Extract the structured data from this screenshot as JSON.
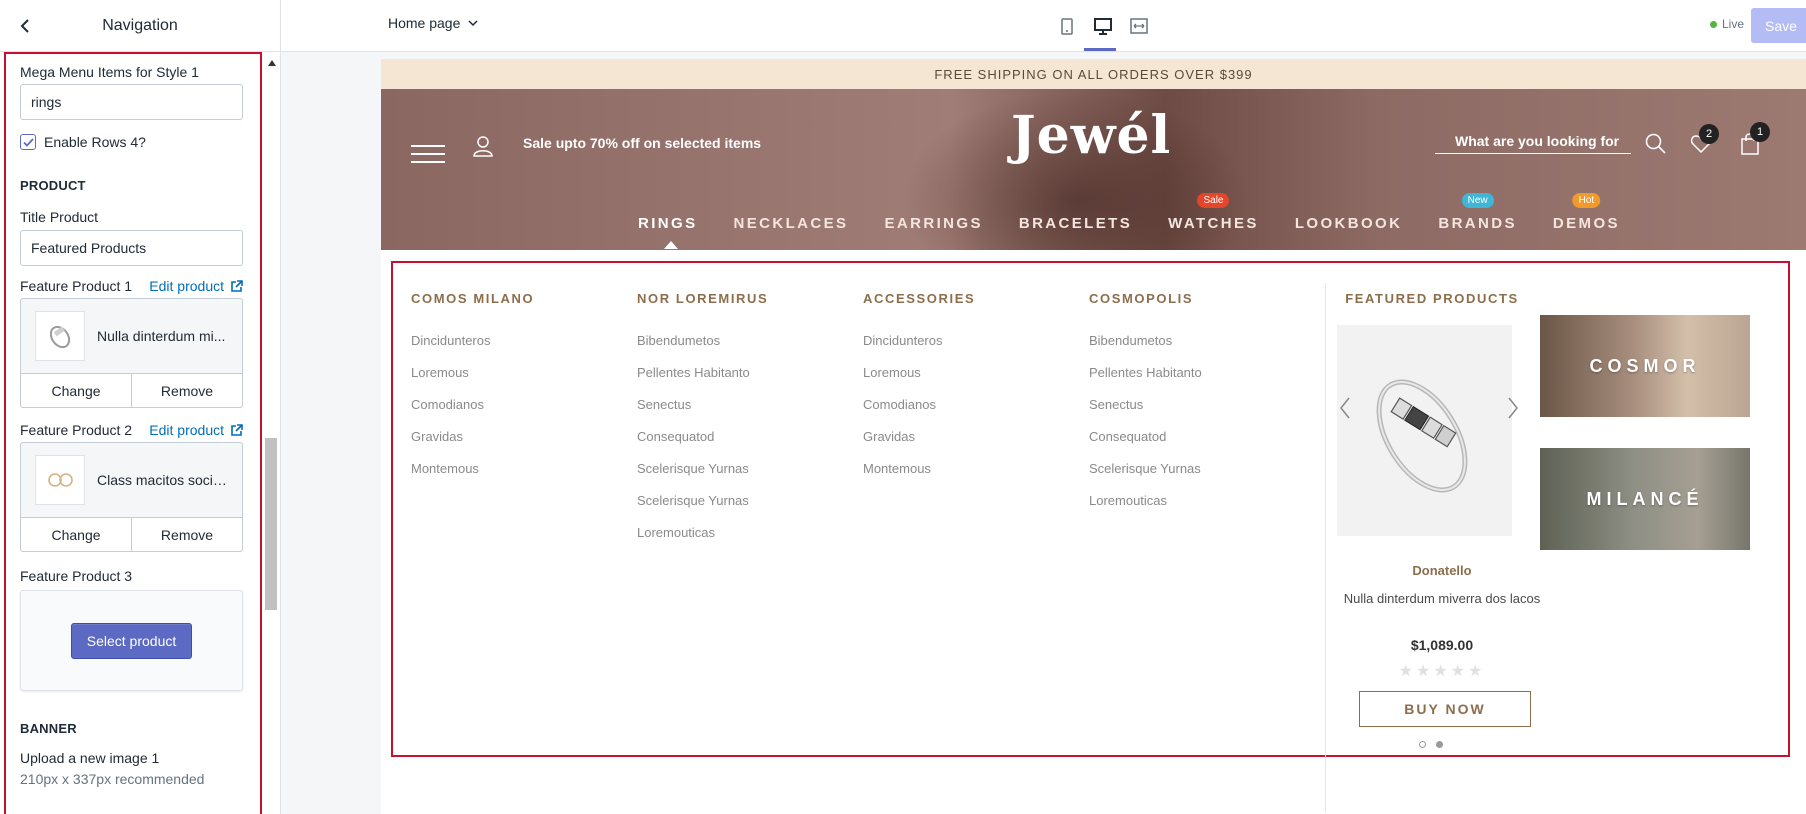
{
  "sidebar": {
    "title": "Navigation",
    "mega_items_label": "Mega Menu Items for Style 1",
    "mega_items_value": "rings",
    "enable_rows_label": "Enable Rows 4?",
    "product_section": "PRODUCT",
    "title_product_label": "Title Product",
    "title_product_value": "Featured Products",
    "edit_product": "Edit product",
    "feature_products": [
      {
        "label": "Feature Product 1",
        "name": "Nulla dinterdum mi...",
        "change": "Change",
        "remove": "Remove"
      },
      {
        "label": "Feature Product 2",
        "name": "Class macitos socio...",
        "change": "Change",
        "remove": "Remove"
      }
    ],
    "feature_product_3_label": "Feature Product 3",
    "select_product": "Select product",
    "banner_section": "BANNER",
    "upload_label": "Upload a new image 1",
    "upload_hint": "210px x 337px recommended"
  },
  "topbar": {
    "page": "Home page",
    "live": "Live",
    "save": "Save"
  },
  "store": {
    "announcement": "FREE SHIPPING ON ALL ORDERS OVER $399",
    "promo": "Sale upto 70% off on selected items",
    "logo": "Jewél",
    "search_placeholder": "What are you looking for",
    "wishlist_count": "2",
    "cart_count": "1",
    "nav": [
      {
        "label": "RINGS",
        "tag": ""
      },
      {
        "label": "NECKLACES",
        "tag": ""
      },
      {
        "label": "EARRINGS",
        "tag": ""
      },
      {
        "label": "BRACELETS",
        "tag": ""
      },
      {
        "label": "WATCHES",
        "tag": "Sale"
      },
      {
        "label": "LOOKBOOK",
        "tag": ""
      },
      {
        "label": "BRANDS",
        "tag": "New"
      },
      {
        "label": "DEMOS",
        "tag": "Hot"
      }
    ],
    "colors": {
      "sale": "#e5462a",
      "new": "#3fb6d6",
      "hot": "#f09a2b",
      "accent": "#5c6ac4",
      "brown": "#8d6e4c"
    }
  },
  "mega": {
    "columns": [
      {
        "heading": "COMOS MILANO",
        "links": [
          "Dincidunteros",
          "Loremous",
          "Comodianos",
          "Gravidas",
          "Montemous"
        ]
      },
      {
        "heading": "NOR LOREMIRUS",
        "links": [
          "Bibendumetos",
          "Pellentes Habitanto",
          "Senectus",
          "Consequatod",
          "Scelerisque Yurnas",
          "Scelerisque Yurnas",
          "Loremouticas"
        ]
      },
      {
        "heading": "ACCESSORIES",
        "links": [
          "Dincidunteros",
          "Loremous",
          "Comodianos",
          "Gravidas",
          "Montemous"
        ]
      },
      {
        "heading": "COSMOPOLIS",
        "links": [
          "Bibendumetos",
          "Pellentes Habitanto",
          "Senectus",
          "Consequatod",
          "Scelerisque Yurnas",
          "Loremouticas"
        ]
      }
    ],
    "featured": {
      "heading": "FEATURED PRODUCTS",
      "brand": "Donatello",
      "name": "Nulla dinterdum miverra dos lacos",
      "price": "$1,089.00",
      "stars": "★★★★★",
      "buy": "BUY NOW"
    },
    "banners": [
      "COSMOR",
      "MILANCÉ"
    ]
  }
}
